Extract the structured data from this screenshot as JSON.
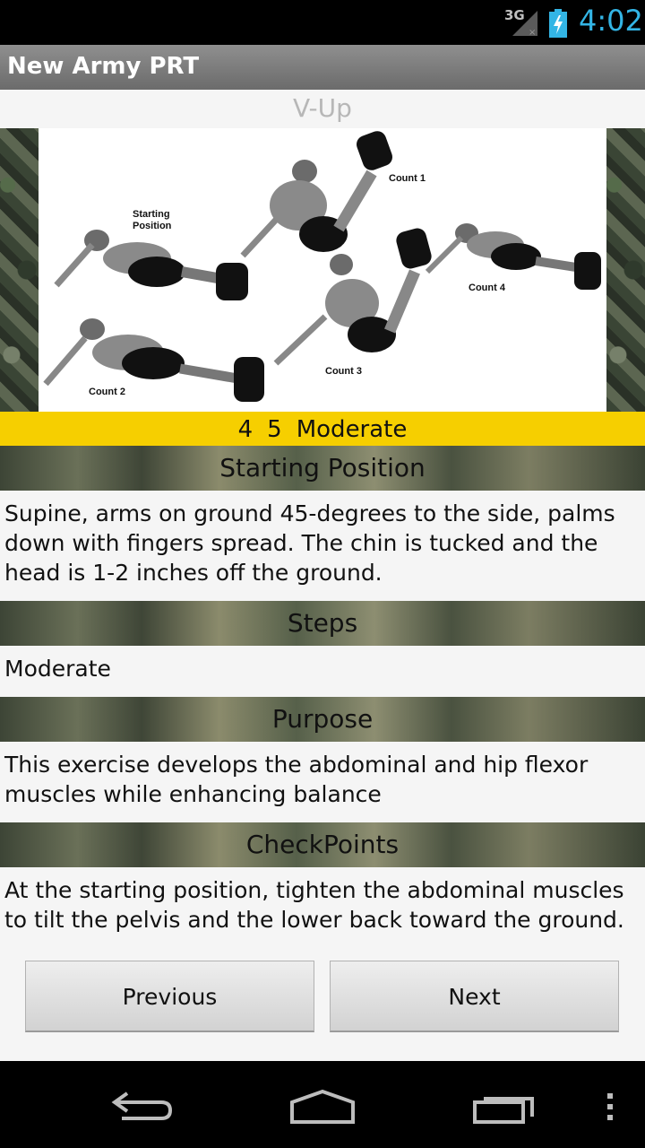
{
  "status_bar": {
    "network": "3G",
    "time": "4:02"
  },
  "app": {
    "title": "New Army PRT"
  },
  "exercise": {
    "title": "V-Up",
    "figure_labels": {
      "starting": "Starting\nPosition",
      "count1": "Count 1",
      "count2": "Count 2",
      "count3": "Count 3",
      "count4": "Count 4"
    },
    "rating": {
      "a": "4",
      "b": "5",
      "level": "Moderate"
    }
  },
  "sections": [
    {
      "header": "Starting Position",
      "text": "Supine, arms on ground 45-degrees to the side, palms down with fingers spread. The chin is tucked and the head is 1-2 inches off the ground."
    },
    {
      "header": "Steps",
      "text": "Moderate"
    },
    {
      "header": "Purpose",
      "text": "This exercise develops the abdominal and hip flexor muscles while enhancing balance"
    },
    {
      "header": "CheckPoints",
      "text": "At the starting position, tighten the abdominal muscles to tilt the pelvis and the lower back toward the ground."
    }
  ],
  "buttons": {
    "previous": "Previous",
    "next": "Next"
  },
  "nav_icons": [
    "back-icon",
    "home-icon",
    "recent-apps-icon",
    "overflow-menu-icon"
  ],
  "colors": {
    "accent_clock": "#33b5e5",
    "rating_bar": "#f6cf00"
  }
}
